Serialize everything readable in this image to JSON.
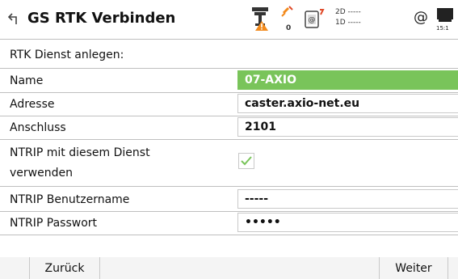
{
  "header": {
    "title": "GS RTK Verbinden",
    "status": {
      "satellites_count": "0",
      "quality_2d": "2D -----",
      "quality_1d": "1D -----",
      "time": "15:1"
    }
  },
  "form": {
    "section_label": "RTK Dienst anlegen:",
    "name_label": "Name",
    "name_value": "07-AXIO",
    "address_label": "Adresse",
    "address_value": "caster.axio-net.eu",
    "port_label": "Anschluss",
    "port_value": "2101",
    "ntrip_use_label_line1": "NTRIP mit diesem Dienst",
    "ntrip_use_label_line2": "verwenden",
    "ntrip_use_checked": true,
    "ntrip_user_label": "NTRIP Benutzername",
    "ntrip_user_value": "-----",
    "ntrip_password_label": "NTRIP Passwort",
    "ntrip_password_value": "•••••"
  },
  "footer": {
    "back_label": "Zurück",
    "next_label": "Weiter"
  },
  "colors": {
    "accent_green": "#79c45a",
    "warning_orange": "#f28a1c"
  }
}
